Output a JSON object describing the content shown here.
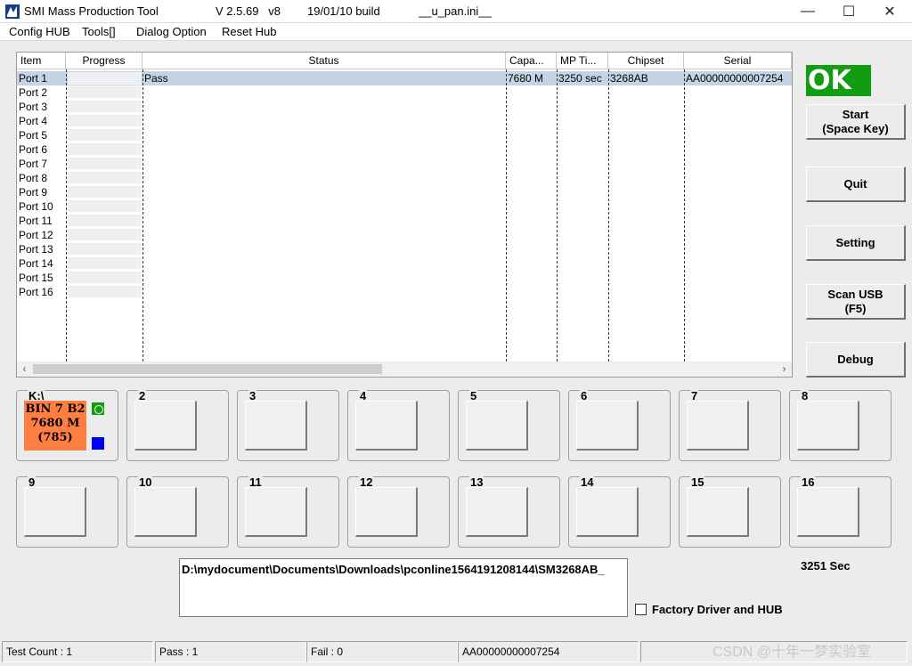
{
  "window": {
    "app_name": "SMI Mass Production Tool",
    "version": "V 2.5.69   v8",
    "build": "19/01/10 build",
    "ini": "__u_pan.ini__",
    "minimize_glyph": "—",
    "maximize_glyph": "☐",
    "close_glyph": "✕"
  },
  "menu": {
    "config_hub": "Config HUB",
    "tools": "Tools[]",
    "dialog_option": "Dialog Option",
    "reset_hub": "Reset Hub"
  },
  "table": {
    "columns": [
      "Item",
      "Progress",
      "Status",
      "Capa...",
      "MP Ti...",
      "Chipset",
      "Serial"
    ],
    "ports": [
      "Port 1",
      "Port 2",
      "Port 3",
      "Port 4",
      "Port 5",
      "Port 6",
      "Port 7",
      "Port 8",
      "Port 9",
      "Port 10",
      "Port 11",
      "Port 12",
      "Port 13",
      "Port 14",
      "Port 15",
      "Port 16"
    ],
    "row1": {
      "status": "Pass",
      "capacity": "7680 M",
      "mp_time": "3250 sec",
      "chipset": "3268AB",
      "serial": "AA00000000007254"
    },
    "scroll_left": "‹",
    "scroll_right": "›"
  },
  "buttons": {
    "ok": "OK",
    "start_line1": "Start",
    "start_line2": "(Space Key)",
    "quit": "Quit",
    "setting": "Setting",
    "scan_line1": "Scan USB",
    "scan_line2": "(F5)",
    "debug": "Debug"
  },
  "port_panels": {
    "p1_label": "K:\\",
    "p1_bin_line1": "BIN 7 B2",
    "p1_bin_line2": "7680 M",
    "p1_bin_line3": "(785)",
    "labels": [
      "2",
      "3",
      "4",
      "5",
      "6",
      "7",
      "8",
      "9",
      "10",
      "11",
      "12",
      "13",
      "14",
      "15",
      "16"
    ]
  },
  "bottom": {
    "path": "D:\\mydocument\\Documents\\Downloads\\pconline1564191208144\\SM3268AB_",
    "elapsed": "3251 Sec",
    "factory_label": "Factory Driver and HUB"
  },
  "statusbar": {
    "test_count": "Test Count : 1",
    "pass": "Pass : 1",
    "fail": "Fail : 0",
    "serial": "AA00000000007254"
  },
  "watermark": "CSDN @十年一梦实验室",
  "colors": {
    "ok_green": "#119c11",
    "bin_orange": "#ff7f42",
    "selected_row": "#c5d4e4",
    "led_blue": "#0000ff"
  }
}
